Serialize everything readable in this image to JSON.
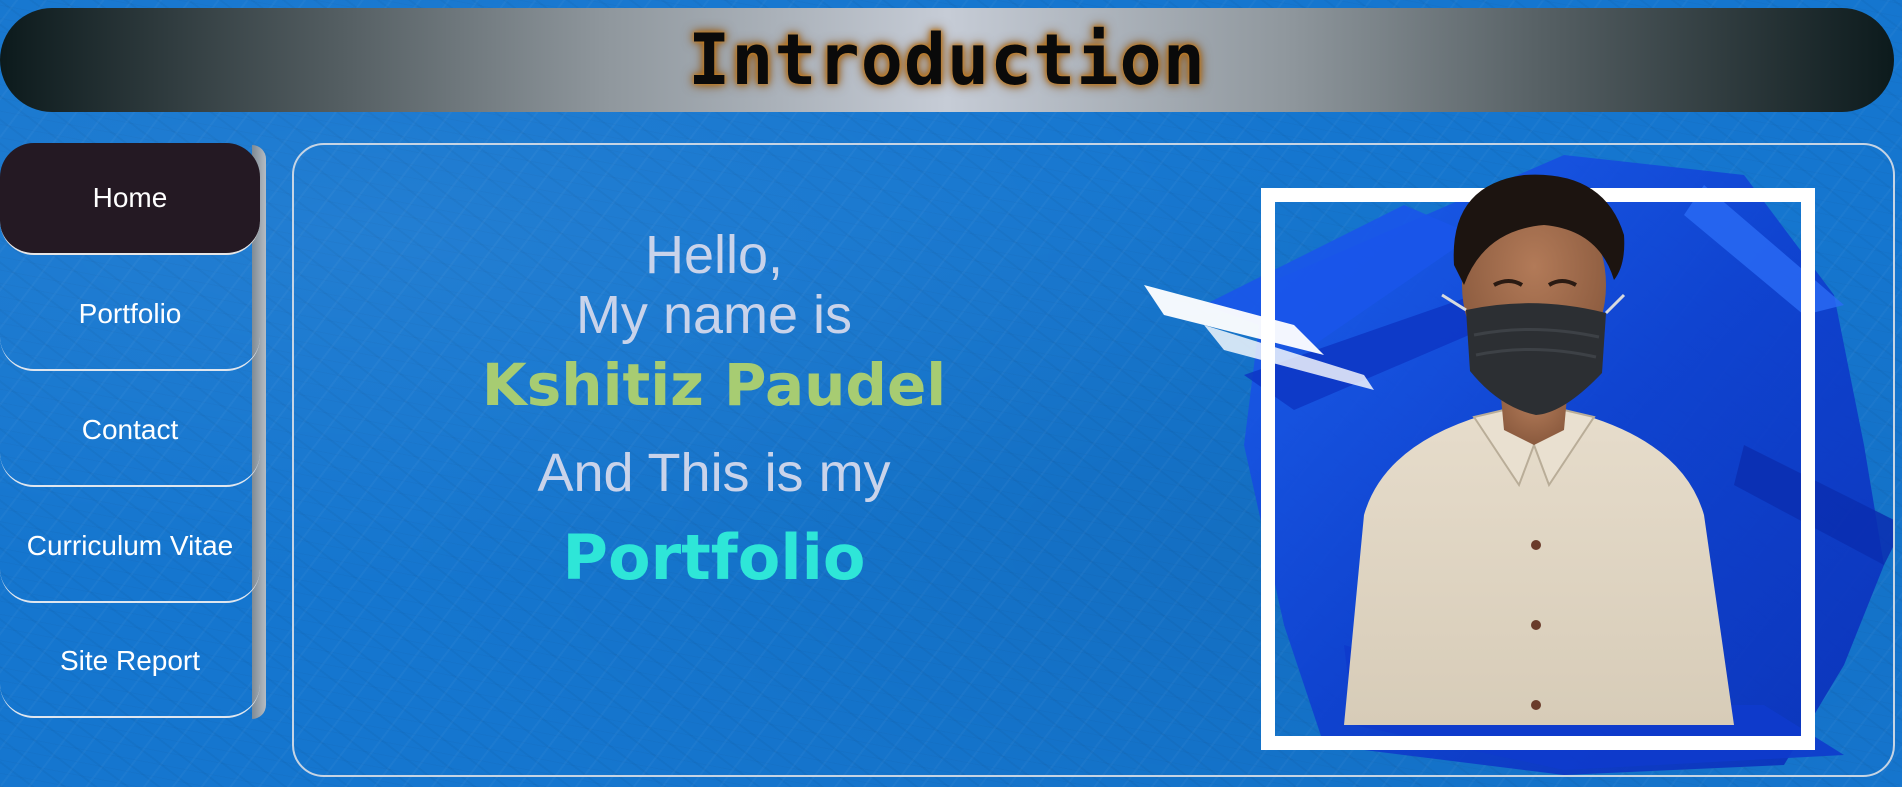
{
  "header": {
    "title": "Introduction"
  },
  "sidebar": {
    "items": [
      {
        "label": "Home",
        "active": true
      },
      {
        "label": "Portfolio",
        "active": false
      },
      {
        "label": "Contact",
        "active": false
      },
      {
        "label": "Curriculum Vitae",
        "active": false
      },
      {
        "label": "Site Report",
        "active": false
      }
    ]
  },
  "main": {
    "greeting_line1": "Hello,",
    "greeting_line2": "My name is",
    "name": "Kshitiz Paudel",
    "subtitle": "And This is my",
    "highlight": "Portfolio"
  },
  "colors": {
    "page_background": "#1576cf",
    "active_nav": "#241923",
    "name_text": "#a7cc72",
    "highlight_text": "#2ee6d8",
    "greeting_text": "#c9d3ea"
  }
}
